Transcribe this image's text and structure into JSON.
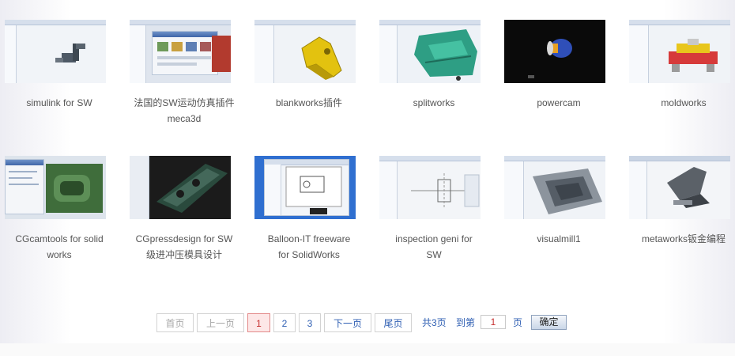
{
  "items": [
    {
      "caption": [
        "simulink for SW"
      ],
      "thumb_icon": "robot-arm-cad-icon"
    },
    {
      "caption": [
        "法国的SW运动仿真插件",
        "meca3d"
      ],
      "thumb_icon": "dialog-window-icon"
    },
    {
      "caption": [
        "blankworks插件"
      ],
      "thumb_icon": "yellow-part-icon"
    },
    {
      "caption": [
        "splitworks"
      ],
      "thumb_icon": "green-mold-icon"
    },
    {
      "caption": [
        "powercam"
      ],
      "thumb_icon": "blue-cylinder-icon"
    },
    {
      "caption": [
        "moldworks"
      ],
      "thumb_icon": "mold-assembly-icon"
    },
    {
      "caption": [
        "CGcamtools for solid",
        "works"
      ],
      "thumb_icon": "green-block-icon"
    },
    {
      "caption": [
        "CGpressdesign for SW",
        "级进冲压模具设计"
      ],
      "thumb_icon": "die-strip-icon"
    },
    {
      "caption": [
        "Balloon-IT freeware",
        "for SolidWorks"
      ],
      "thumb_icon": "drawing-sheet-icon"
    },
    {
      "caption": [
        "inspection geni for",
        "SW"
      ],
      "thumb_icon": "drawing-view-icon"
    },
    {
      "caption": [
        "visualmill1"
      ],
      "thumb_icon": "pocket-toolpath-icon"
    },
    {
      "caption": [
        "metaworks钣金编程"
      ],
      "thumb_icon": "sheet-metal-icon"
    }
  ],
  "pager": {
    "first": "首页",
    "prev": "上一页",
    "pages": [
      "1",
      "2",
      "3"
    ],
    "current": "1",
    "next": "下一页",
    "last": "尾页",
    "total": "共3页",
    "goto_label": "到第",
    "goto_value": "1",
    "page_unit": "页",
    "confirm": "确定"
  },
  "colors": {
    "link": "#2f5fb3",
    "current_page": "#c62f2f",
    "caption": "#555555"
  }
}
